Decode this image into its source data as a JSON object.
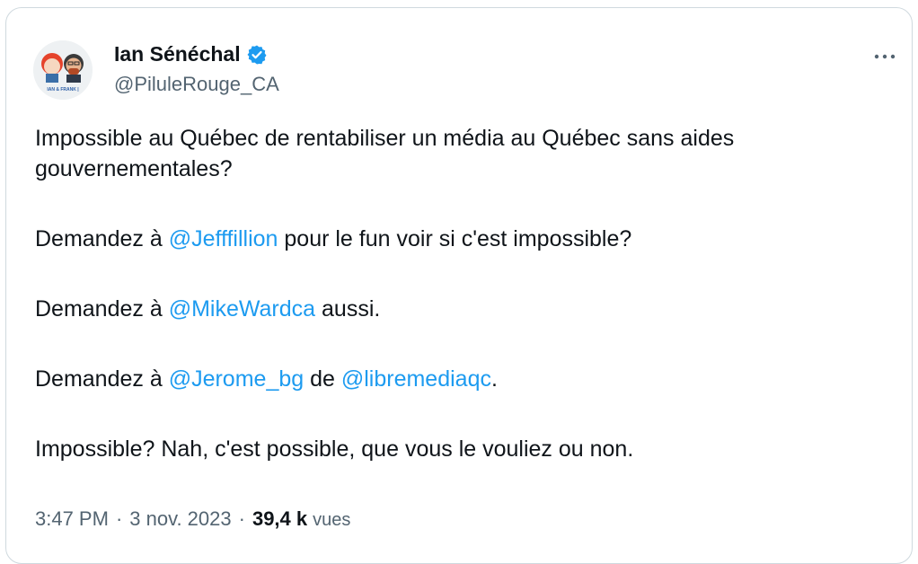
{
  "author": {
    "display_name": "Ian Sénéchal",
    "handle": "@PiluleRouge_CA",
    "avatar_caption": "IAN & FRANK |",
    "verified_color": "#1d9bf0"
  },
  "tweet": {
    "p1": "Impossible au Québec de rentabiliser un média au Québec sans aides gouvernementales?",
    "p2_pre": "Demandez à ",
    "p2_mention": "@Jefffillion",
    "p2_post": " pour le fun voir si c'est impossible?",
    "p3_pre": "Demandez à ",
    "p3_mention": "@MikeWardca",
    "p3_post": " aussi.",
    "p4_pre": "Demandez à ",
    "p4_mention1": "@Jerome_bg",
    "p4_mid": " de ",
    "p4_mention2": "@libremediaqc",
    "p4_post": ".",
    "p5": "Impossible? Nah, c'est possible, que vous le vouliez ou non."
  },
  "meta": {
    "time": "3:47 PM",
    "separator": "·",
    "date": "3 nov. 2023",
    "views_count": "39,4 k",
    "views_label": "vues"
  },
  "colors": {
    "mention": "#1d9bf0",
    "secondary_text": "#536471",
    "border": "#cfd9de"
  },
  "icons": {
    "verified": "verified-badge-icon",
    "more": "more-options-icon"
  }
}
